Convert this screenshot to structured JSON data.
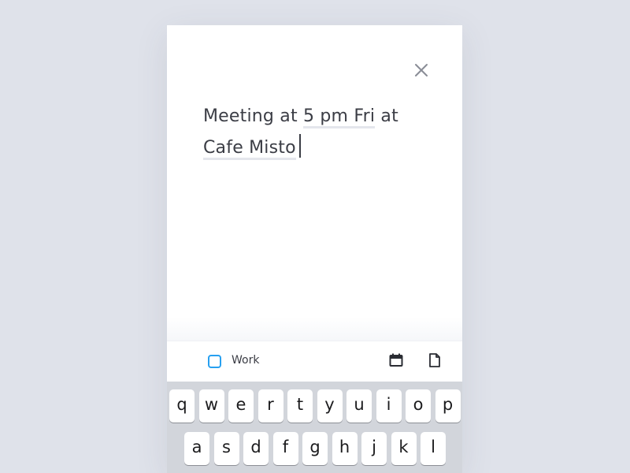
{
  "note": {
    "text_part1": "Meeting at ",
    "entity_time": "5 pm Fri",
    "text_part2": " at",
    "entity_place": "Cafe Misto"
  },
  "header": {
    "close_icon": "close-icon"
  },
  "toolbar": {
    "list_label": "Work",
    "checkbox_color": "#27a0f0",
    "icons": [
      "calendar-icon",
      "document-icon"
    ]
  },
  "keyboard": {
    "row1": [
      "q",
      "w",
      "e",
      "r",
      "t",
      "y",
      "u",
      "i",
      "o",
      "p"
    ],
    "row2": [
      "a",
      "s",
      "d",
      "f",
      "g",
      "h",
      "j",
      "k",
      "l"
    ]
  },
  "colors": {
    "background": "#dfe2ea",
    "text": "#3b3d45",
    "underline": "#e4e6ec",
    "keyboard_bg": "#d2d5db"
  }
}
